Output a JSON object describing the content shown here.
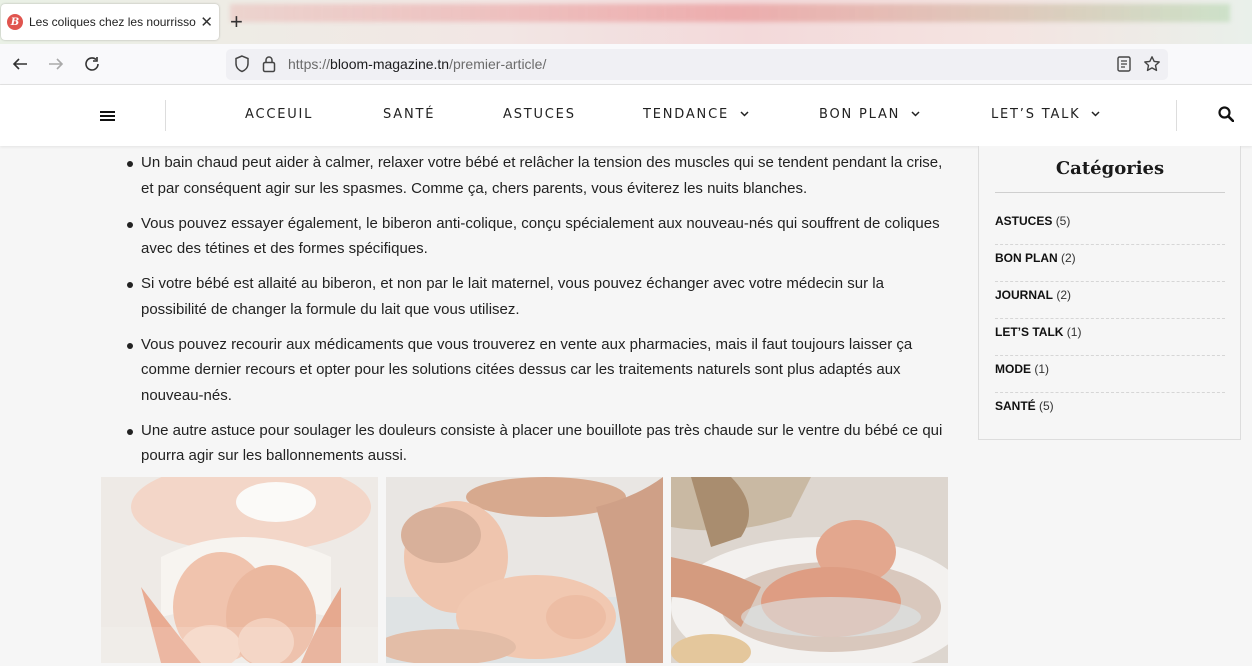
{
  "browser": {
    "tab_title": "Les coliques chez les nourrissons",
    "favicon_letter": "B",
    "url_host_prefix": "https://",
    "url_host": "bloom-magazine.tn",
    "url_path": "/premier-article/"
  },
  "site_nav": {
    "items": [
      {
        "label": "ACCEUIL",
        "has_dropdown": false
      },
      {
        "label": "SANTÉ",
        "has_dropdown": false
      },
      {
        "label": "ASTUCES",
        "has_dropdown": false
      },
      {
        "label": "TENDANCE",
        "has_dropdown": true
      },
      {
        "label": "BON PLAN",
        "has_dropdown": true
      },
      {
        "label": "LET’S TALK",
        "has_dropdown": true
      }
    ],
    "chevron": "⌄"
  },
  "article": {
    "bullets": [
      "Un bain chaud peut aider à calmer, relaxer votre bébé et relâcher la tension des muscles qui se tendent pendant la crise, et par conséquent agir sur les spasmes. Comme ça, chers parents, vous éviterez les nuits blanches.",
      "Vous pouvez essayer également, le biberon anti-colique, conçu spécialement aux nouveau-nés qui souffrent de coliques avec des tétines et des formes spécifiques.",
      "Si votre bébé est allaité au biberon, et non par le lait maternel, vous pouvez échanger avec votre médecin sur la possibilité de changer la formule du lait que vous utilisez.",
      "Vous pouvez recourir aux médicaments que vous trouverez en vente aux pharmacies, mais il faut toujours laisser ça comme dernier recours et opter pour les solutions citées dessus car les traitements naturels sont plus adaptés aux nouveau-nés.",
      "Une autre astuce pour soulager les douleurs consiste à placer une bouillote pas très chaude sur le ventre du bébé ce qui pourra agir sur les ballonnements aussi."
    ]
  },
  "sidebar": {
    "title": "Catégories",
    "categories": [
      {
        "name": "ASTUCES",
        "count": "(5)"
      },
      {
        "name": "BON PLAN",
        "count": "(2)"
      },
      {
        "name": "JOURNAL",
        "count": "(2)"
      },
      {
        "name": "LET’S TALK",
        "count": "(1)"
      },
      {
        "name": "MODE",
        "count": "(1)"
      },
      {
        "name": "SANTÉ",
        "count": "(5)"
      }
    ]
  }
}
